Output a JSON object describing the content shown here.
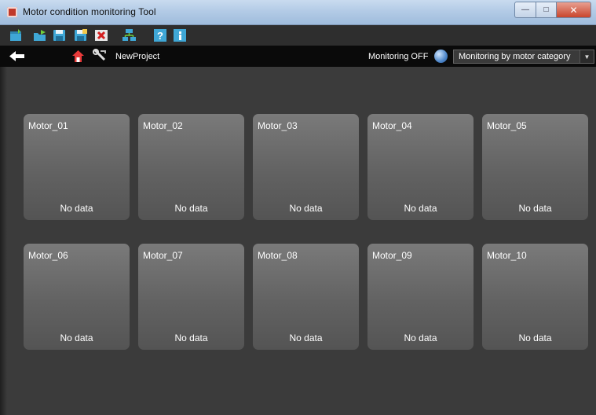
{
  "window": {
    "title": "Motor condition monitoring Tool"
  },
  "toolbar": {
    "icons": [
      "new-project-icon",
      "open-project-icon",
      "save-icon",
      "save-as-icon",
      "delete-icon",
      "network-icon",
      "help-icon",
      "info-icon"
    ]
  },
  "navbar": {
    "project_name": "NewProject",
    "monitoring_status": "Monitoring OFF",
    "mode_select_value": "Monitoring by motor category"
  },
  "motors": [
    {
      "name": "Motor_01",
      "status": "No data"
    },
    {
      "name": "Motor_02",
      "status": "No data"
    },
    {
      "name": "Motor_03",
      "status": "No data"
    },
    {
      "name": "Motor_04",
      "status": "No data"
    },
    {
      "name": "Motor_05",
      "status": "No data"
    },
    {
      "name": "Motor_06",
      "status": "No data"
    },
    {
      "name": "Motor_07",
      "status": "No data"
    },
    {
      "name": "Motor_08",
      "status": "No data"
    },
    {
      "name": "Motor_09",
      "status": "No data"
    },
    {
      "name": "Motor_10",
      "status": "No data"
    }
  ],
  "colors": {
    "background": "#3b3b3b",
    "card": "#6a6a6a",
    "navbar": "#0a0a0a",
    "accent": "#2e7fd1"
  }
}
